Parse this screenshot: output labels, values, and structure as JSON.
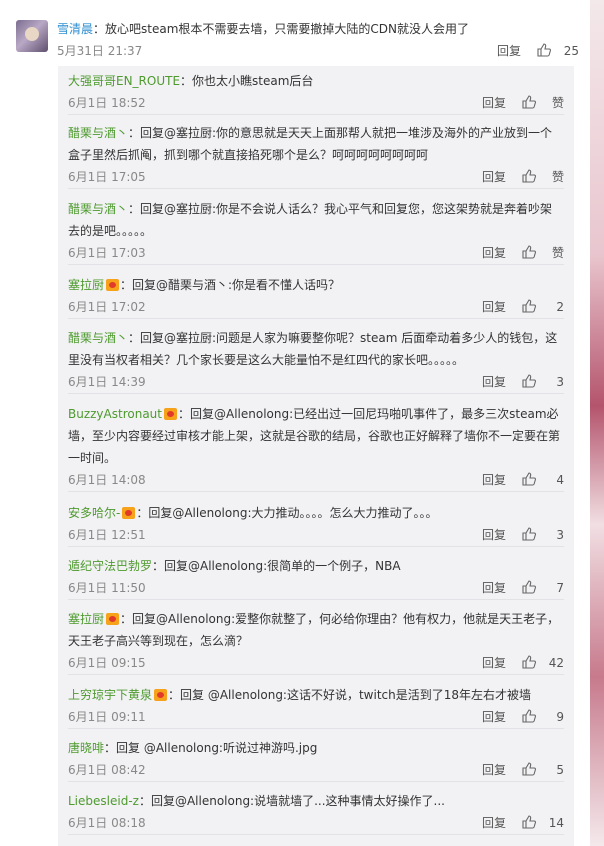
{
  "colors": {
    "username_green": "#4e9a2e",
    "username_blue": "#2f8fd1",
    "thread_bg": "#f2f2f5"
  },
  "top_comment": {
    "user": "雪清晨",
    "text": "放心吧steam根本不需要去墙，只需要撤掉大陆的CDN就没人会用了",
    "time": "5月31日 21:37",
    "reply_label": "回复",
    "likes": "25"
  },
  "replies": [
    {
      "user": "大强哥哥EN_ROUTE",
      "badge": false,
      "text": "：你也太小瞧steam后台",
      "time": "6月1日 18:52",
      "reply_label": "回复",
      "likes": "赞"
    },
    {
      "user": "醋栗与酒丶",
      "badge": false,
      "text": "：回复@塞拉厨:你的意思就是天天上面那帮人就把一堆涉及海外的产业放到一个盒子里然后抓阄，抓到哪个就直接掐死哪个是么？呵呵呵呵呵呵呵呵",
      "time": "6月1日 17:05",
      "reply_label": "回复",
      "likes": "赞"
    },
    {
      "user": "醋栗与酒丶",
      "badge": false,
      "text": "：回复@塞拉厨:你是不会说人话么？我心平气和回复您，您这架势就是奔着吵架去的是吧。。。。。",
      "time": "6月1日 17:03",
      "reply_label": "回复",
      "likes": "赞"
    },
    {
      "user": "塞拉厨",
      "badge": true,
      "text": "：回复@醋栗与酒丶:你是看不懂人话吗？",
      "time": "6月1日 17:02",
      "reply_label": "回复",
      "likes": "2"
    },
    {
      "user": "醋栗与酒丶",
      "badge": false,
      "text": "：回复@塞拉厨:问题是人家为嘛要整你呢？steam 后面牵动着多少人的钱包，这里没有当权者相关？几个家长要是这么大能量怕不是红四代的家长吧。。。。。",
      "time": "6月1日 14:39",
      "reply_label": "回复",
      "likes": "3"
    },
    {
      "user": "BuzzyAstronaut",
      "badge": true,
      "text": "：回复@Allenolong:已经出过一回尼玛啪叽事件了，最多三次steam必墙，至少内容要经过审核才能上架，这就是谷歌的结局，谷歌也正好解释了墙你不一定要在第一时间。",
      "time": "6月1日 14:08",
      "reply_label": "回复",
      "likes": "4"
    },
    {
      "user": "安多哈尔-",
      "badge": true,
      "text": "：回复@Allenolong:大力推动。。。。怎么大力推动了。。。",
      "time": "6月1日 12:51",
      "reply_label": "回复",
      "likes": "3"
    },
    {
      "user": "遁纪守法巴勃罗",
      "badge": false,
      "text": "：回复@Allenolong:很简单的一个例子，NBA",
      "time": "6月1日 11:50",
      "reply_label": "回复",
      "likes": "7"
    },
    {
      "user": "塞拉厨",
      "badge": true,
      "text": "：回复@Allenolong:爱整你就整了，何必给你理由？他有权力，他就是天王老子，天王老子高兴等到现在，怎么滴？",
      "time": "6月1日 09:15",
      "reply_label": "回复",
      "likes": "42"
    },
    {
      "user": "上穷琼宇下黄泉",
      "badge": true,
      "text": "：回复 @Allenolong:这话不好说，twitch是活到了18年左右才被墙",
      "time": "6月1日 09:11",
      "reply_label": "回复",
      "likes": "9"
    },
    {
      "user": "唐晓啡",
      "badge": false,
      "text": "：回复 @Allenolong:听说过神游吗.jpg",
      "time": "6月1日 08:42",
      "reply_label": "回复",
      "likes": "5"
    },
    {
      "user": "Liebesleid-z",
      "badge": false,
      "text": "：回复@Allenolong:说墙就墙了...这种事情太好操作了...",
      "time": "6月1日 08:18",
      "reply_label": "回复",
      "likes": "14"
    }
  ]
}
